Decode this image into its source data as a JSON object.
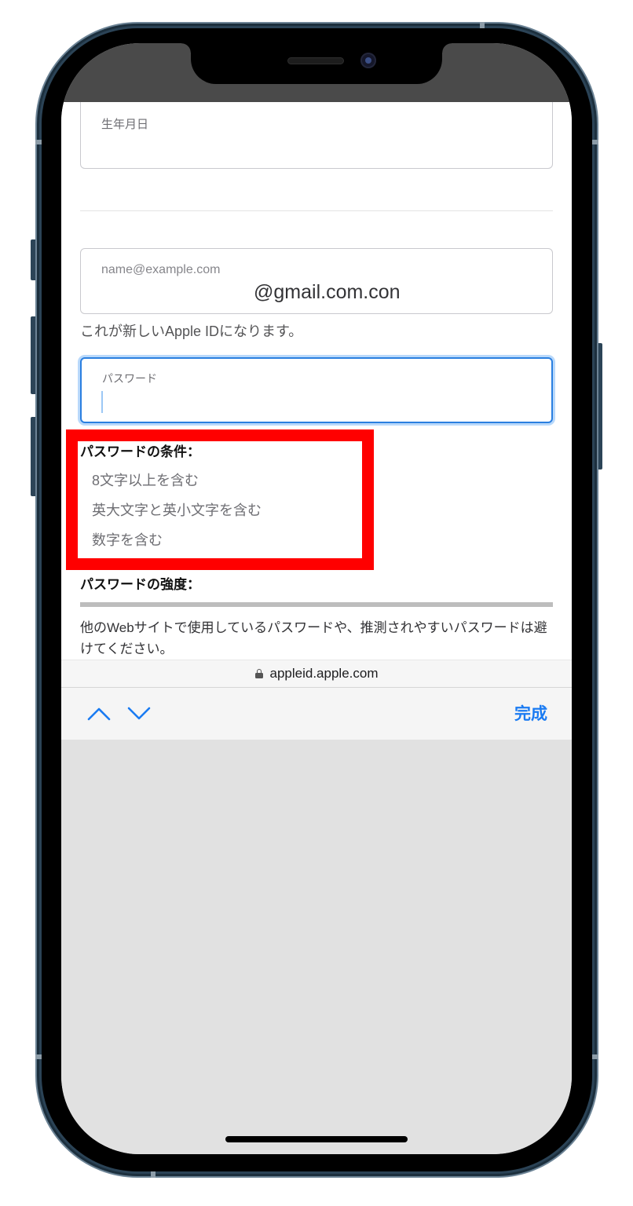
{
  "device": {
    "model": "iPhone",
    "frame_color": "#2b4356"
  },
  "colors": {
    "accent": "#1a7bf2",
    "highlight": "#ff0000",
    "focus_border": "#2a7fe0",
    "strength_empty": "#bdbdbd"
  },
  "form": {
    "birthdate": {
      "label": "生年月日"
    },
    "email": {
      "label": "name@example.com",
      "value": "@gmail.com.con",
      "hint": "これが新しいApple IDになります。"
    },
    "password": {
      "label": "パスワード",
      "focused": true
    },
    "requirements": {
      "title": "パスワードの条件：",
      "items": [
        "8文字以上を含む",
        "英大文字と英小文字を含む",
        "数字を含む"
      ]
    },
    "strength": {
      "title": "パスワードの強度：",
      "level": 0
    },
    "advice": "他のWebサイトで使用しているパスワードや、推測されやすいパスワードは避けてください。"
  },
  "browser": {
    "url": "appleid.apple.com",
    "secure_icon": "lock-icon"
  },
  "keyboard_toolbar": {
    "prev_icon": "chevron-up-icon",
    "next_icon": "chevron-down-icon",
    "done_label": "完成"
  }
}
